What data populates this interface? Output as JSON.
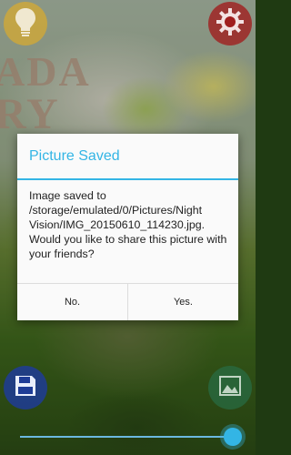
{
  "background": {
    "printed_text_line1": "ADA",
    "printed_text_line2": "RY"
  },
  "controls": {
    "flash_icon": "lightbulb-icon",
    "settings_icon": "gear-icon",
    "save_icon": "floppy-disk-icon",
    "gallery_icon": "picture-icon",
    "slider_value_fraction": 0.98
  },
  "dialog": {
    "title": "Picture Saved",
    "message": "Image saved to /storage/emulated/0/Pictures/Night Vision/IMG_20150610_114230.jpg. Would you like to share this picture with your friends?",
    "negative_label": "No.",
    "positive_label": "Yes."
  },
  "colors": {
    "accent": "#33b5e5",
    "settings_button": "#a01e1e",
    "save_button": "#1e3c96",
    "flash_button": "#d6aa32"
  }
}
